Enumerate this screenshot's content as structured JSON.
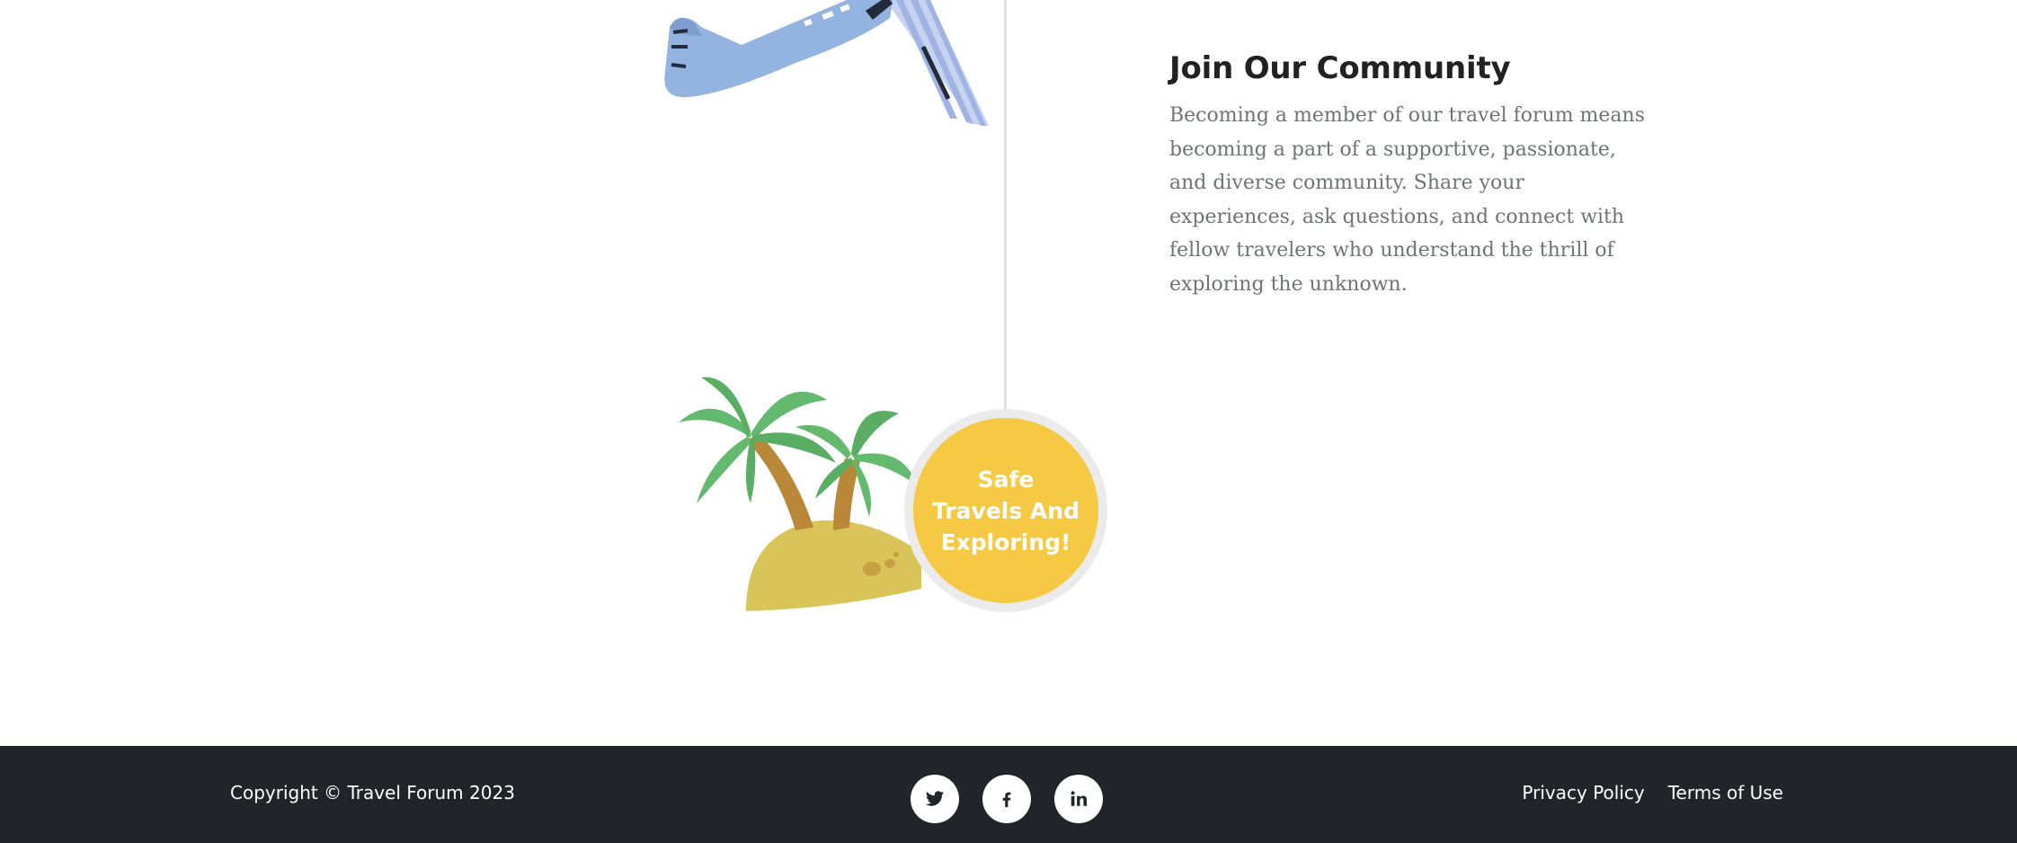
{
  "section": {
    "title": "Join Our Community",
    "body": "Becoming a member of our travel forum means becoming a part of a supportive, passionate, and diverse community. Share your experiences, ask questions, and connect with fellow travelers who understand the thrill of exploring the unknown."
  },
  "milestone": {
    "label": "Safe Travels And Exploring!"
  },
  "illustrations": {
    "top": "airplane-icon",
    "bottom": "palm-island-icon"
  },
  "footer": {
    "copyright": "Copyright © Travel Forum 2023",
    "social": [
      {
        "icon": "twitter-icon"
      },
      {
        "icon": "facebook-icon"
      },
      {
        "icon": "linkedin-icon"
      }
    ],
    "links": [
      "Privacy Policy",
      "Terms of Use"
    ]
  },
  "colors": {
    "footer_bg": "#212429",
    "milestone_fill": "#f6c945",
    "milestone_ring": "#ebebeb",
    "title": "#222222",
    "body_text": "#6f7378",
    "plane": "#93b3e0",
    "palm_leaf": "#63b96d",
    "palm_trunk": "#b98838",
    "sand": "#d9c45a"
  }
}
